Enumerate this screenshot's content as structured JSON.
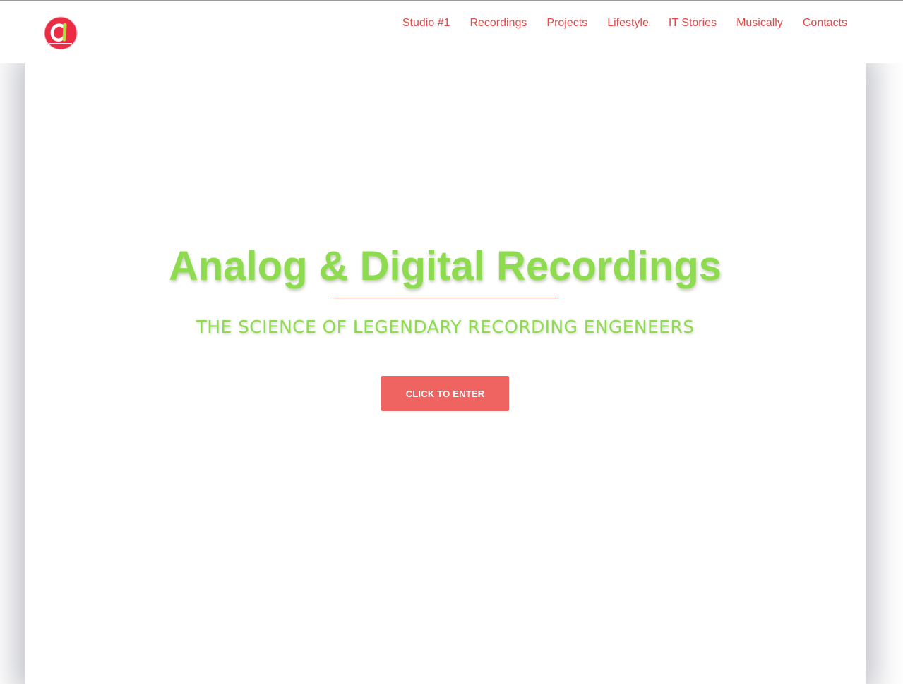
{
  "nav": {
    "items": [
      {
        "label": "Studio #1"
      },
      {
        "label": "Recordings"
      },
      {
        "label": "Projects"
      },
      {
        "label": "Lifestyle"
      },
      {
        "label": "IT Stories"
      },
      {
        "label": "Musically"
      },
      {
        "label": "Contacts"
      }
    ]
  },
  "logo": {
    "icon": "ci-monogram-logo-icon"
  },
  "hero": {
    "title": "Analog & Digital Recordings",
    "subtitle": "THE SCIENCE OF LEGENDARY RECORDING ENGENEERS",
    "button_label": "CLICK TO ENTER"
  },
  "colors": {
    "accent_green": "#8fdb4f",
    "accent_red": "#ef6461",
    "nav_text": "#e04a4a"
  }
}
